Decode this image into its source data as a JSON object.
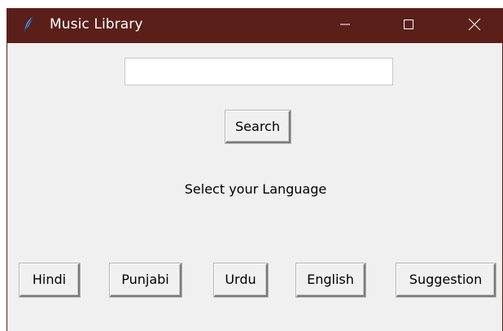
{
  "window": {
    "title": "Music Library",
    "app_icon": "feather-icon",
    "controls": {
      "minimize_icon": "minimize-icon",
      "maximize_icon": "maximize-icon",
      "close_icon": "close-icon"
    },
    "titlebar_color": "#5a1f19",
    "background_color": "#f0f0f0"
  },
  "search": {
    "value": "",
    "placeholder": "",
    "button_label": "Search"
  },
  "prompt": "Select your Language",
  "language_buttons": {
    "hindi": "Hindi",
    "punjabi": "Punjabi",
    "urdu": "Urdu",
    "english": "English",
    "suggestion": "Suggestion"
  }
}
